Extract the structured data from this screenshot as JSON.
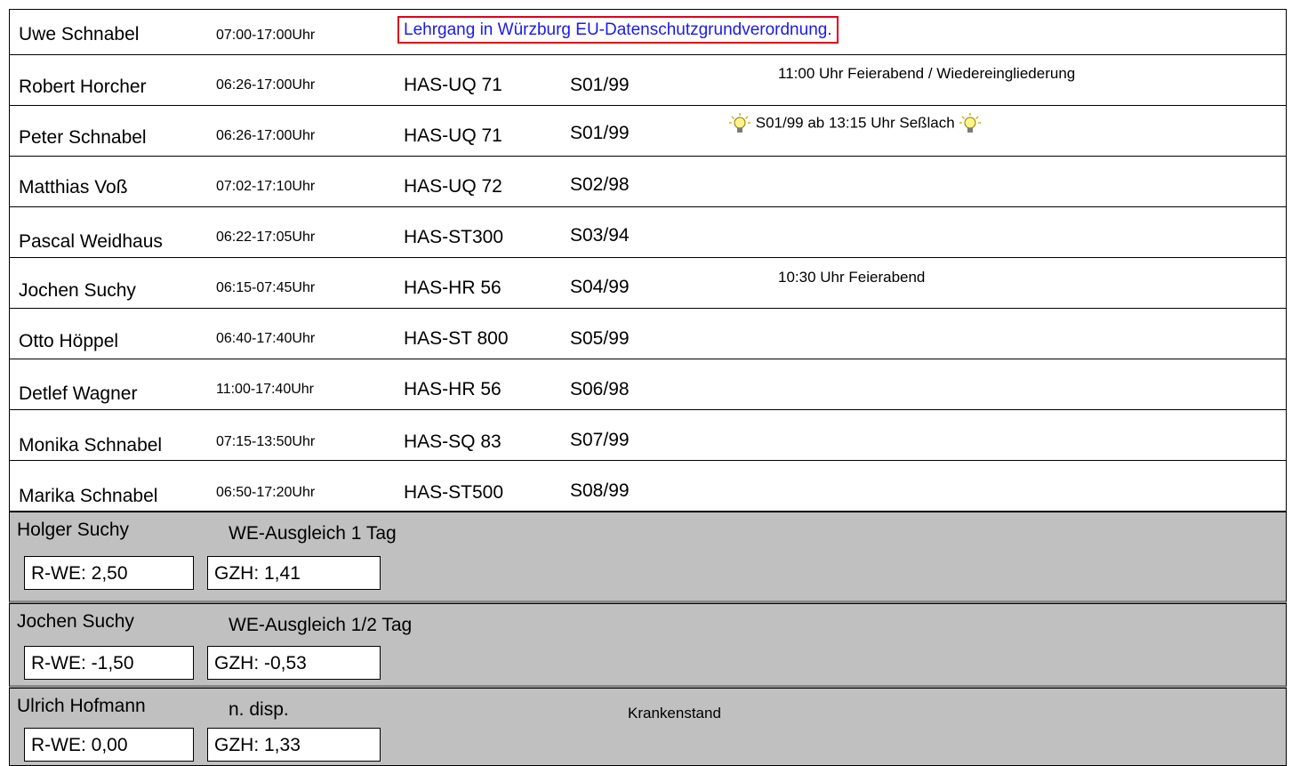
{
  "course_note": "Lehrgang in Würzburg EU-Datenschutzgrundverordnung.",
  "rows": [
    {
      "name": "Uwe Schnabel",
      "time": "07:00-17:00Uhr",
      "vehicle": "",
      "route": "",
      "note": ""
    },
    {
      "name": "Robert Horcher",
      "time": "06:26-17:00Uhr",
      "vehicle": "HAS-UQ 71",
      "route": "S01/99",
      "note": "11:00 Uhr Feierabend / Wiedereingliederung"
    },
    {
      "name": "Peter Schnabel",
      "time": "06:26-17:00Uhr",
      "vehicle": "HAS-UQ 71",
      "route": "S01/99",
      "note": "S01/99 ab 13:15 Uhr Seßlach"
    },
    {
      "name": "Matthias Voß",
      "time": "07:02-17:10Uhr",
      "vehicle": "HAS-UQ 72",
      "route": "S02/98",
      "note": ""
    },
    {
      "name": "Pascal Weidhaus",
      "time": "06:22-17:05Uhr",
      "vehicle": "HAS-ST300",
      "route": "S03/94",
      "note": ""
    },
    {
      "name": "Jochen Suchy",
      "time": "06:15-07:45Uhr",
      "vehicle": "HAS-HR 56",
      "route": "S04/99",
      "note": "10:30 Uhr Feierabend"
    },
    {
      "name": "Otto Höppel",
      "time": "06:40-17:40Uhr",
      "vehicle": "HAS-ST 800",
      "route": "S05/99",
      "note": ""
    },
    {
      "name": "Detlef Wagner",
      "time": "11:00-17:40Uhr",
      "vehicle": "HAS-HR 56",
      "route": "S06/98",
      "note": ""
    },
    {
      "name": "Monika Schnabel",
      "time": "07:15-13:50Uhr",
      "vehicle": "HAS-SQ 83",
      "route": "S07/99",
      "note": ""
    },
    {
      "name": "Marika Schnabel",
      "time": "06:50-17:20Uhr",
      "vehicle": "HAS-ST500",
      "route": "S08/99",
      "note": ""
    }
  ],
  "absent": [
    {
      "name": "Holger Suchy",
      "label": "WE-Ausgleich 1 Tag",
      "rwe": "R-WE: 2,50",
      "gzh": "GZH: 1,41",
      "note": ""
    },
    {
      "name": "Jochen Suchy",
      "label": "WE-Ausgleich 1/2 Tag",
      "rwe": "R-WE: -1,50",
      "gzh": "GZH: -0,53",
      "note": ""
    },
    {
      "name": "Ulrich Hofmann",
      "label": "n. disp.",
      "rwe": "R-WE: 0,00",
      "gzh": "GZH: 1,33",
      "note": "Krankenstand"
    }
  ],
  "colors": {
    "course_border": "#e0001a",
    "course_text": "#1a1aee",
    "grey_row": "#c0c0c0"
  },
  "icons": {
    "note_marker": "lightbulb-icon"
  }
}
